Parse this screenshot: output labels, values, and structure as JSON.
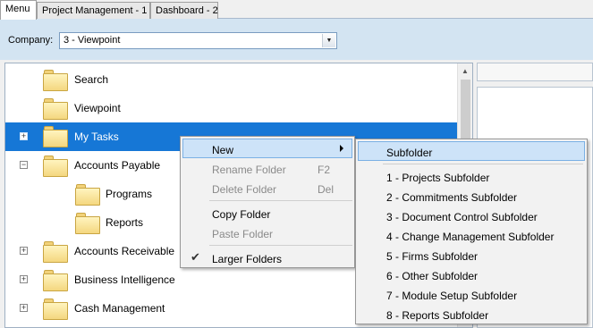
{
  "tabs": [
    {
      "label": "Menu"
    },
    {
      "label": "Project Management - 1"
    },
    {
      "label": "Dashboard - 2"
    }
  ],
  "company": {
    "label": "Company:",
    "value": "3 - Viewpoint"
  },
  "tree": {
    "items": [
      {
        "label": "Search"
      },
      {
        "label": "Viewpoint"
      },
      {
        "label": "My Tasks",
        "expander": "+"
      },
      {
        "label": "Accounts Payable",
        "expander": "−"
      },
      {
        "label": "Programs"
      },
      {
        "label": "Reports"
      },
      {
        "label": "Accounts Receivable",
        "expander": "+"
      },
      {
        "label": "Business Intelligence",
        "expander": "+"
      },
      {
        "label": "Cash Management",
        "expander": "+"
      }
    ]
  },
  "context_menu": {
    "new": "New",
    "rename": "Rename Folder",
    "rename_shortcut": "F2",
    "delete": "Delete Folder",
    "delete_shortcut": "Del",
    "copy": "Copy Folder",
    "paste": "Paste Folder",
    "larger": "Larger Folders"
  },
  "submenu": {
    "items": [
      "Subfolder",
      "1 - Projects Subfolder",
      "2 - Commitments Subfolder",
      "3 - Document Control Subfolder",
      "4 - Change Management Subfolder",
      "5 - Firms Subfolder",
      "6 - Other Subfolder",
      "7 - Module Setup Subfolder",
      "8 - Reports Subfolder"
    ]
  },
  "colors": {
    "selection": "#1677d6",
    "menu_highlight": "#cde3f8",
    "company_bar": "#d3e4f2"
  }
}
